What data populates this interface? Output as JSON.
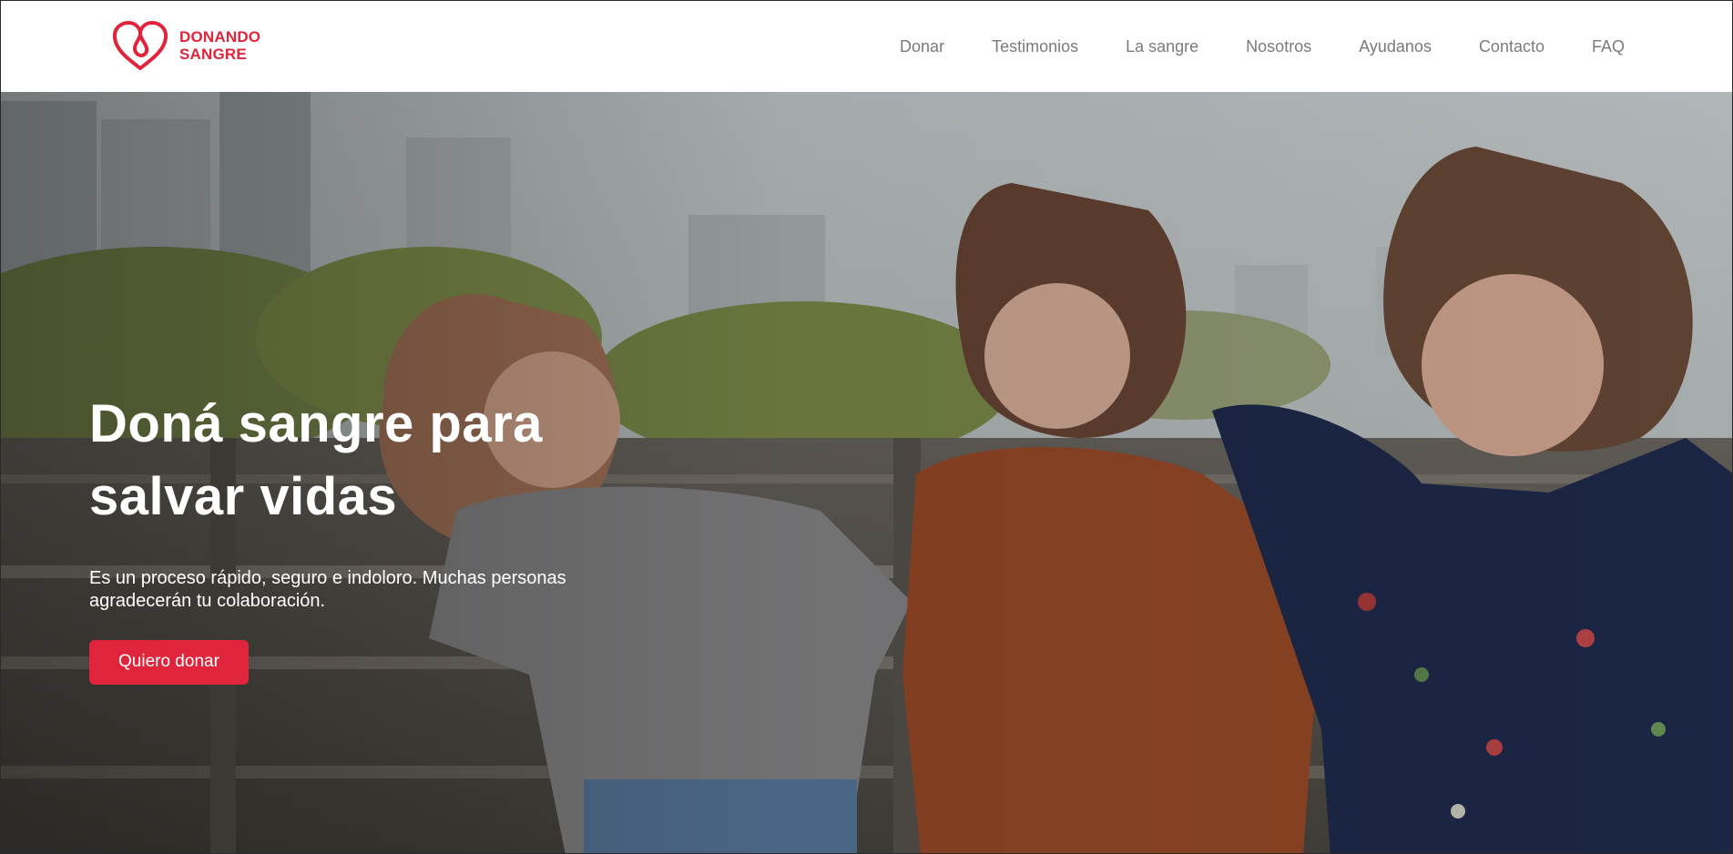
{
  "brand": {
    "line1": "DONANDO",
    "line2": "SANGRE",
    "color": "#e0243c",
    "icon": "heart-loop-icon"
  },
  "nav": {
    "items": [
      {
        "label": "Donar"
      },
      {
        "label": "Testimonios"
      },
      {
        "label": "La sangre"
      },
      {
        "label": "Nosotros"
      },
      {
        "label": "Ayudanos"
      },
      {
        "label": "Contacto"
      },
      {
        "label": "FAQ"
      }
    ]
  },
  "hero": {
    "title_line1": "Doná sangre para",
    "title_line2": "salvar vidas",
    "text": "Es un proceso rápido, seguro e indoloro. Muchas personas agradecerán tu colaboración.",
    "cta_label": "Quiero donar",
    "image": "photo-three-women-laughing"
  }
}
